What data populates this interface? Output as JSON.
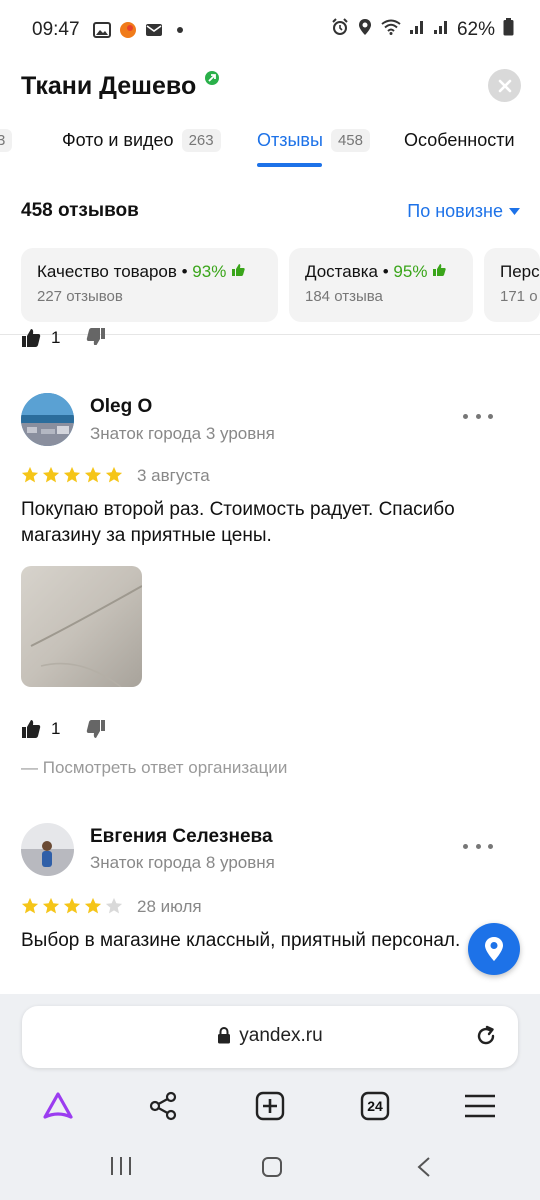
{
  "status_bar": {
    "time": "09:47",
    "battery": "62%"
  },
  "header": {
    "title": "Ткани Дешево"
  },
  "tabs": [
    {
      "label": "",
      "count": "3"
    },
    {
      "label": "Фото и видео",
      "count": "263"
    },
    {
      "label": "Отзывы",
      "count": "458",
      "active": true
    },
    {
      "label": "Особенности",
      "count": ""
    }
  ],
  "reviews": {
    "total_label": "458 отзывов",
    "sort_label": "По новизне"
  },
  "aspects": [
    {
      "name": "Качество товаров",
      "percent": "93%",
      "sub": "227 отзывов"
    },
    {
      "name": "Доставка",
      "percent": "95%",
      "sub": "184 отзыва"
    },
    {
      "name": "Перс",
      "percent": "",
      "sub": "171 о"
    }
  ],
  "partial_review": {
    "likes": "1"
  },
  "review_list": [
    {
      "author": "Oleg O",
      "level": "Знаток города 3 уровня",
      "rating": 5,
      "date": "3 августа",
      "text": "Покупаю второй раз. Стоимость радует. Спасибо магазину за приятные цены.",
      "likes": "1",
      "answer_link": "— Посмотреть ответ организации"
    },
    {
      "author": "Евгения Селезнева",
      "level": "Знаток города 8 уровня",
      "rating": 4,
      "date": "28 июля",
      "text": "Выбор в магазине классный, приятный персонал."
    }
  ],
  "browser": {
    "url": "yandex.ru",
    "tabs_count": "24"
  },
  "colors": {
    "accent": "#1d72e8",
    "positive": "#3aa51a",
    "star": "#f5c518"
  }
}
